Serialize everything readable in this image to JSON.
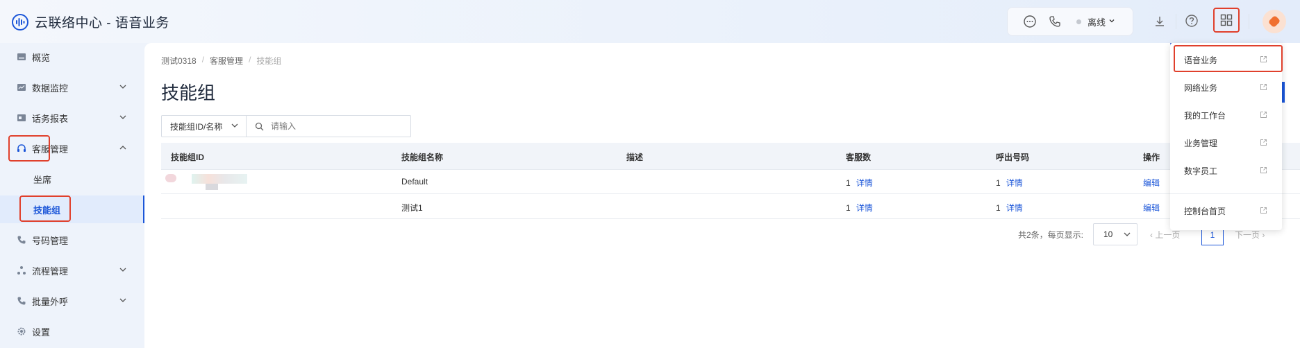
{
  "header": {
    "app_title": "云联络中心 - 语音业务",
    "status_label": "离线",
    "icons": [
      "chat-icon",
      "phone-icon",
      "download-icon",
      "help-icon",
      "apps-grid-icon"
    ]
  },
  "sidebar": {
    "items": [
      {
        "label": "概览",
        "icon": "overview-icon",
        "has_arrow": false
      },
      {
        "label": "数据监控",
        "icon": "monitor-icon",
        "has_arrow": true
      },
      {
        "label": "话务报表",
        "icon": "report-icon",
        "has_arrow": true
      },
      {
        "label": "客服管理",
        "icon": "headset-icon",
        "has_arrow": true,
        "expanded": true
      },
      {
        "label": "号码管理",
        "icon": "phone-icon",
        "has_arrow": false
      },
      {
        "label": "流程管理",
        "icon": "flow-icon",
        "has_arrow": true
      },
      {
        "label": "批量外呼",
        "icon": "batch-call-icon",
        "has_arrow": true
      },
      {
        "label": "设置",
        "icon": "gear-icon",
        "has_arrow": false
      }
    ],
    "sub_items": [
      {
        "label": "坐席"
      },
      {
        "label": "技能组",
        "active": true
      }
    ]
  },
  "breadcrumb": [
    "测试0318",
    "客服管理",
    "技能组"
  ],
  "page_title": "技能组",
  "filter": {
    "select_value": "技能组ID/名称",
    "search_placeholder": "请输入"
  },
  "table": {
    "headers": [
      "技能组ID",
      "技能组名称",
      "描述",
      "客服数",
      "呼出号码",
      "操作"
    ],
    "rows": [
      {
        "id": "",
        "name": "Default",
        "desc": "",
        "agents": "1",
        "agents_link": "详情",
        "outbound": "1",
        "outbound_link": "详情",
        "action": "编辑"
      },
      {
        "id": "",
        "name": "测试1",
        "desc": "",
        "agents": "1",
        "agents_link": "详情",
        "outbound": "1",
        "outbound_link": "详情",
        "action": "编辑"
      }
    ]
  },
  "pagination": {
    "summary": "共2条，每页显示:",
    "page_size": "10",
    "prev": "上一页",
    "current": "1",
    "next": "下一页"
  },
  "dropdown": {
    "items": [
      "语音业务",
      "网络业务",
      "我的工作台",
      "业务管理",
      "数字员工"
    ],
    "footer_item": "控制台首页"
  },
  "colors": {
    "accent": "#1a55d8",
    "highlight_box": "#e0402c",
    "sidebar_bg": "#eef3fb"
  }
}
